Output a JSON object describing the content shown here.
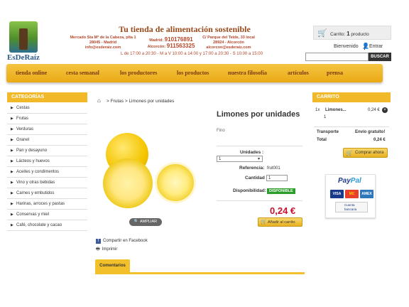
{
  "brand": {
    "logo_text": "EsDeRaíz",
    "tagline": "Tu tienda de alimentación sostenible"
  },
  "stores": [
    {
      "address": "Mercado Sta Mª de la Cabeza, plta 1",
      "city": "28045 - Madrid",
      "email": "info@esderaiz.com"
    },
    {
      "phone_madrid_label": "Madrid:",
      "phone_madrid": "910176891",
      "phone_alcorcon_label": "Alcorcón:",
      "phone_alcorcon": "911563325"
    },
    {
      "address": "C/ Parque del Teide, 33 local",
      "city": "28924 - Alcorcón",
      "email": "alcorcon@esderaiz.com"
    }
  ],
  "hours": "L de 17:00 a 20:30 - M a V 10:00 a 14:00 y 17:00 a 20:30 - S 10:00 a 15:00",
  "header": {
    "cart_label": "Carrito:",
    "cart_count": "1",
    "cart_unit": "producto",
    "welcome": "Bienvenido",
    "login": "Entrar",
    "search_placeholder": "",
    "search_button": "BUSCAR"
  },
  "nav": [
    "tienda online",
    "cesta semanal",
    "los productores",
    "los productos",
    "nuestra filosofía",
    "artículos",
    "prensa"
  ],
  "sidebar": {
    "title": "CATEGORÍAS",
    "items": [
      "Cestas",
      "Frutas",
      "Verduras",
      "Granel",
      "Pan y desayuno",
      "Lácteos y huevos",
      "Aceites y condimentos",
      "Vino y otras bebidas",
      "Carnes y embutidos",
      "Harinas, arroces y pastas",
      "Conservas y miel",
      "Café, chocolate y cacao"
    ]
  },
  "breadcrumb": {
    "sep": ">",
    "path": "Frutas > Limones por unidades"
  },
  "product": {
    "title": "Limones por unidades",
    "description": "Fino",
    "units_label": "Unidades :",
    "units_value": "1",
    "reference_label": "Referencia:",
    "reference_value": "frut001",
    "quantity_label": "Cantidad",
    "quantity_value": "1",
    "availability_label": "Disponibilidad:",
    "availability_value": "DISPONIBLE",
    "price": "0,24 €",
    "add_button": "Añadir al carrito",
    "zoom_button": "AMPLIAR",
    "share": "Compartir en Facebook",
    "print": "Imprimir",
    "tab": "Comentarios"
  },
  "cart": {
    "title": "CARRITO",
    "item_qty": "1x",
    "item_name": "Limones...",
    "item_units": "1",
    "item_price": "0,24 €",
    "shipping_label": "Transporte",
    "shipping_value": "Envío gratuito!",
    "total_label": "Total",
    "total_value": "0,24 €",
    "buy_button": "Comprar ahora"
  },
  "payment": {
    "logo_a": "Pay",
    "logo_b": "Pal",
    "cards": [
      "VISA",
      "MC",
      "AMEX"
    ],
    "bank": "Cuenta bancaria"
  },
  "colors": {
    "accent": "#f1b92a",
    "nav_text": "#7a3a10",
    "price": "#c8102e",
    "available": "#2a9d2a"
  }
}
